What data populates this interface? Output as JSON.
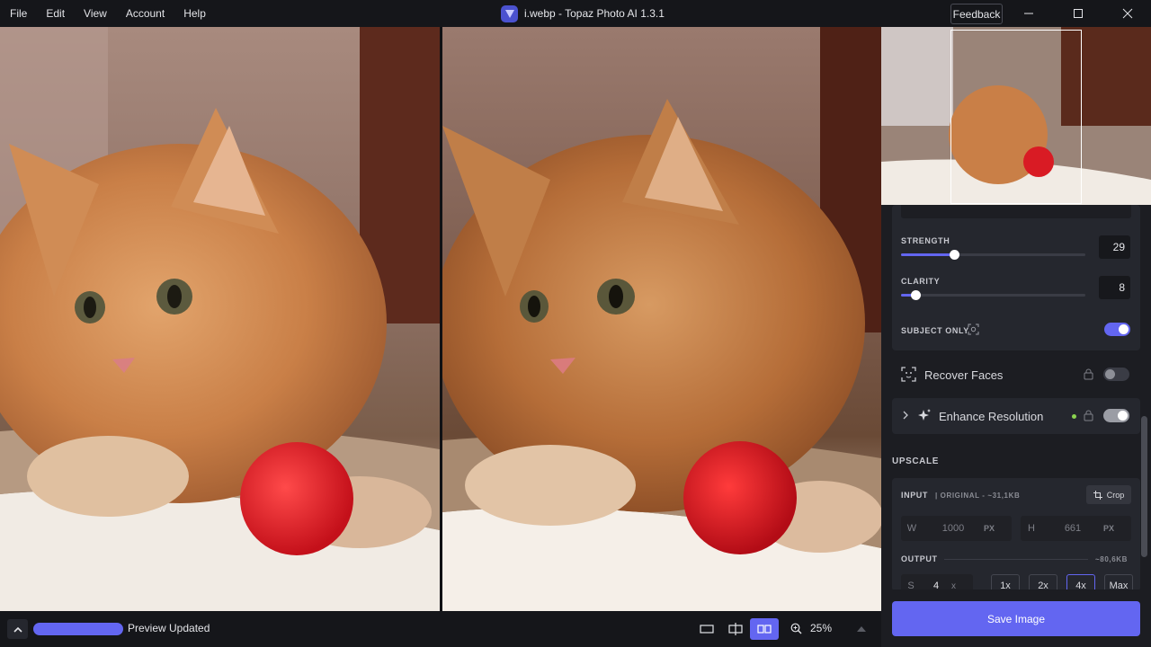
{
  "menu": [
    "File",
    "Edit",
    "View",
    "Account",
    "Help"
  ],
  "window": {
    "title": "i.webp - Topaz Photo AI 1.3.1",
    "feedback": "Feedback"
  },
  "sharpen": {
    "strength_label": "STRENGTH",
    "strength_value": "29",
    "strength_fraction": 0.29,
    "clarity_label": "CLARITY",
    "clarity_value": "8",
    "clarity_fraction": 0.08,
    "subject_only_label": "SUBJECT ONLY",
    "subject_only_on": true
  },
  "recover_faces": {
    "label": "Recover Faces",
    "enabled": false
  },
  "enhance_resolution": {
    "label": "Enhance Resolution",
    "enabled": true
  },
  "upscale": {
    "section_title": "UPSCALE",
    "input_label": "INPUT",
    "input_info": "| ORIGINAL - ~31,1KB",
    "crop_label": "Crop",
    "w_label": "W",
    "w_value": "1000",
    "w_unit": "PX",
    "h_label": "H",
    "h_value": "661",
    "h_unit": "PX",
    "output_label": "OUTPUT",
    "output_size": "~80,6KB",
    "scale_label": "S",
    "scale_value": "4",
    "scale_unit": "x",
    "multipliers": [
      "1x",
      "2x",
      "4x",
      "Max"
    ],
    "selected_multiplier": "4x"
  },
  "save_button": "Save Image",
  "status": {
    "text": "Preview Updated",
    "zoom": "25%"
  },
  "colors": {
    "accent": "#6366f1",
    "background": "#1c1d22",
    "titlebar": "#15161a",
    "status_dot": "#8bd450"
  }
}
